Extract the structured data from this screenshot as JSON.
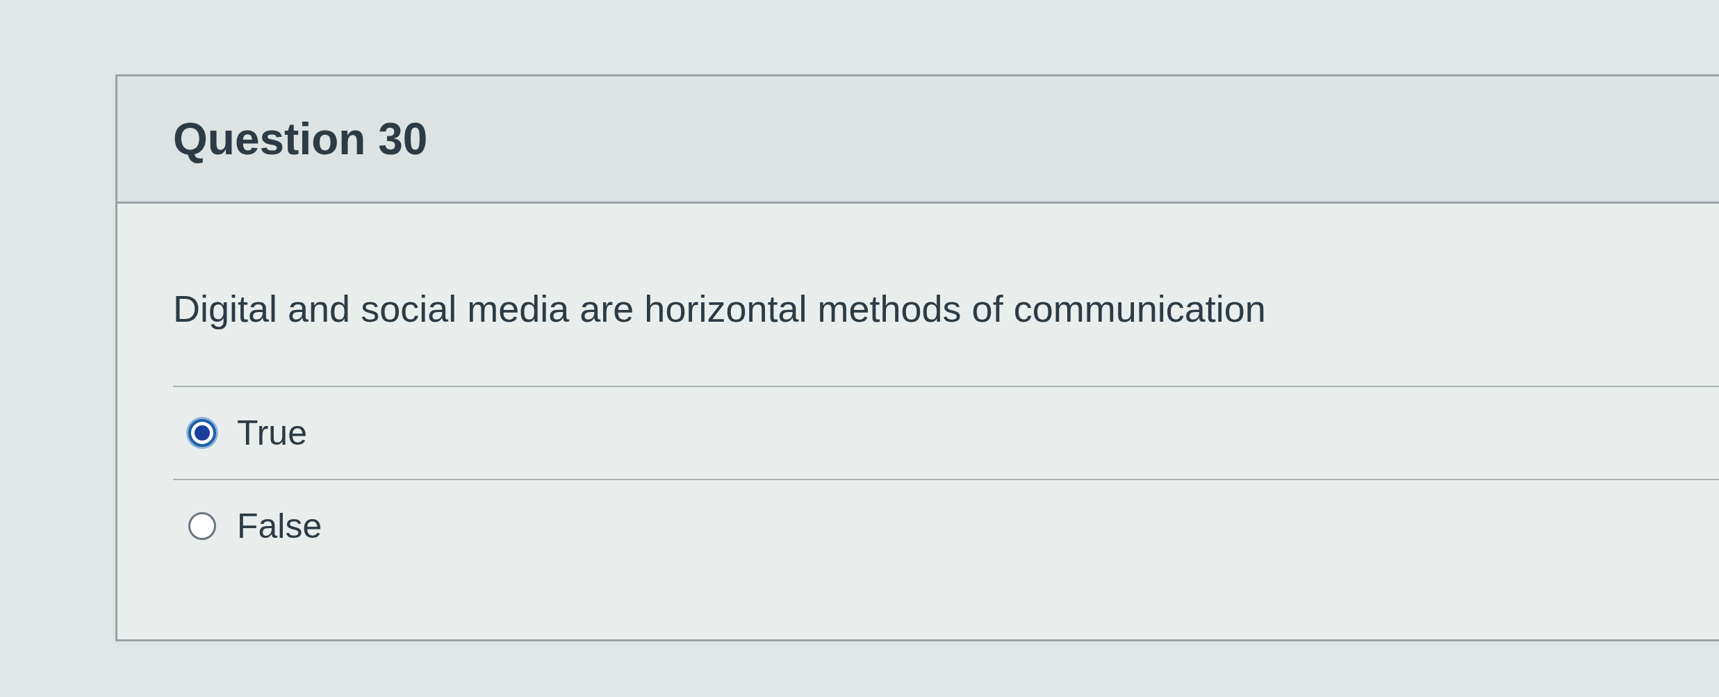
{
  "question": {
    "title": "Question 30",
    "text": "Digital and social media are horizontal methods of communication",
    "answers": [
      {
        "label": "True",
        "selected": true
      },
      {
        "label": "False",
        "selected": false
      }
    ]
  }
}
